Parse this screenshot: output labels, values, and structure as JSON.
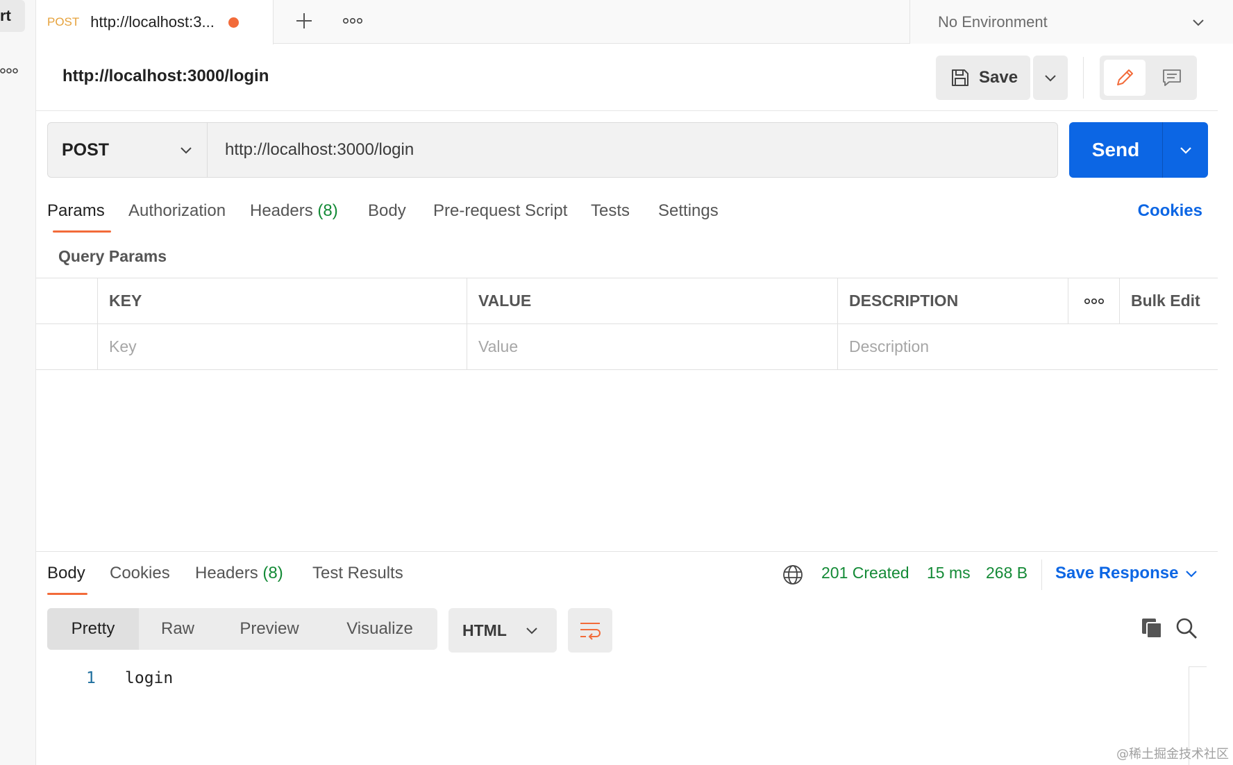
{
  "sidebar": {
    "partial_label": "rt"
  },
  "tab": {
    "method": "POST",
    "title": "http://localhost:3..."
  },
  "environment": {
    "label": "No Environment"
  },
  "request": {
    "title": "http://localhost:3000/login",
    "save_label": "Save",
    "method": "POST",
    "url": "http://localhost:3000/login",
    "send_label": "Send"
  },
  "request_tabs": {
    "params": "Params",
    "authorization": "Authorization",
    "headers": "Headers",
    "headers_count": "(8)",
    "body": "Body",
    "prerequest": "Pre-request Script",
    "tests": "Tests",
    "settings": "Settings",
    "cookies": "Cookies"
  },
  "query_params": {
    "title": "Query Params",
    "columns": {
      "key": "KEY",
      "value": "VALUE",
      "description": "DESCRIPTION",
      "bulk_edit": "Bulk Edit"
    },
    "placeholders": {
      "key": "Key",
      "value": "Value",
      "description": "Description"
    }
  },
  "response": {
    "tabs": {
      "body": "Body",
      "cookies": "Cookies",
      "headers": "Headers",
      "headers_count": "(8)",
      "test_results": "Test Results"
    },
    "status": "201 Created",
    "time": "15 ms",
    "size": "268 B",
    "save_response": "Save Response",
    "formats": {
      "pretty": "Pretty",
      "raw": "Raw",
      "preview": "Preview",
      "visualize": "Visualize"
    },
    "language": "HTML",
    "lines": [
      {
        "number": "1",
        "text": "login"
      }
    ]
  },
  "watermark": "@稀土掘金技术社区",
  "colors": {
    "accent": "#f26b3a",
    "primary": "#0c66e4",
    "success": "#138a36",
    "method_tab": "#e6a23c"
  }
}
